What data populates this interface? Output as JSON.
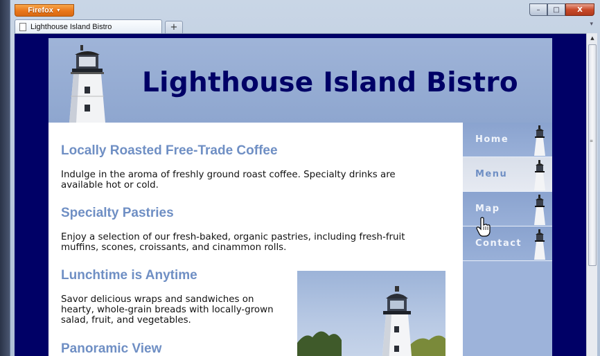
{
  "browser": {
    "app_button": "Firefox",
    "tab_title": "Lighthouse Island Bistro",
    "new_tab_label": "+",
    "window_controls": {
      "minimize": "–",
      "maximize": "□",
      "close": "X"
    }
  },
  "site": {
    "title": "Lighthouse Island Bistro",
    "nav": [
      "Home",
      "Menu",
      "Map",
      "Contact"
    ],
    "active_nav": "Menu",
    "sections": [
      {
        "heading": "Locally Roasted Free-Trade Coffee",
        "text": "Indulge in the aroma of freshly ground roast coffee. Specialty drinks are available hot or cold."
      },
      {
        "heading": "Specialty Pastries",
        "text": "Enjoy a selection of our fresh-baked, organic pastries, including fresh-fruit muffins, scones, croissants, and cinammon rolls."
      },
      {
        "heading": "Lunchtime is Anytime",
        "text": "Savor delicious wraps and sandwiches on hearty, whole-grain breads with locally-grown salad, fruit, and vegetables."
      },
      {
        "heading": "Panoramic View",
        "text": ""
      }
    ]
  },
  "colors": {
    "page_background": "#000066",
    "header_bg": "#8ea6cf",
    "heading": "#6f8fc4",
    "title": "#000066",
    "nav_bg": "#9db3da"
  },
  "icons": [
    "document-icon",
    "lighthouse-icon",
    "hand-cursor-icon"
  ]
}
